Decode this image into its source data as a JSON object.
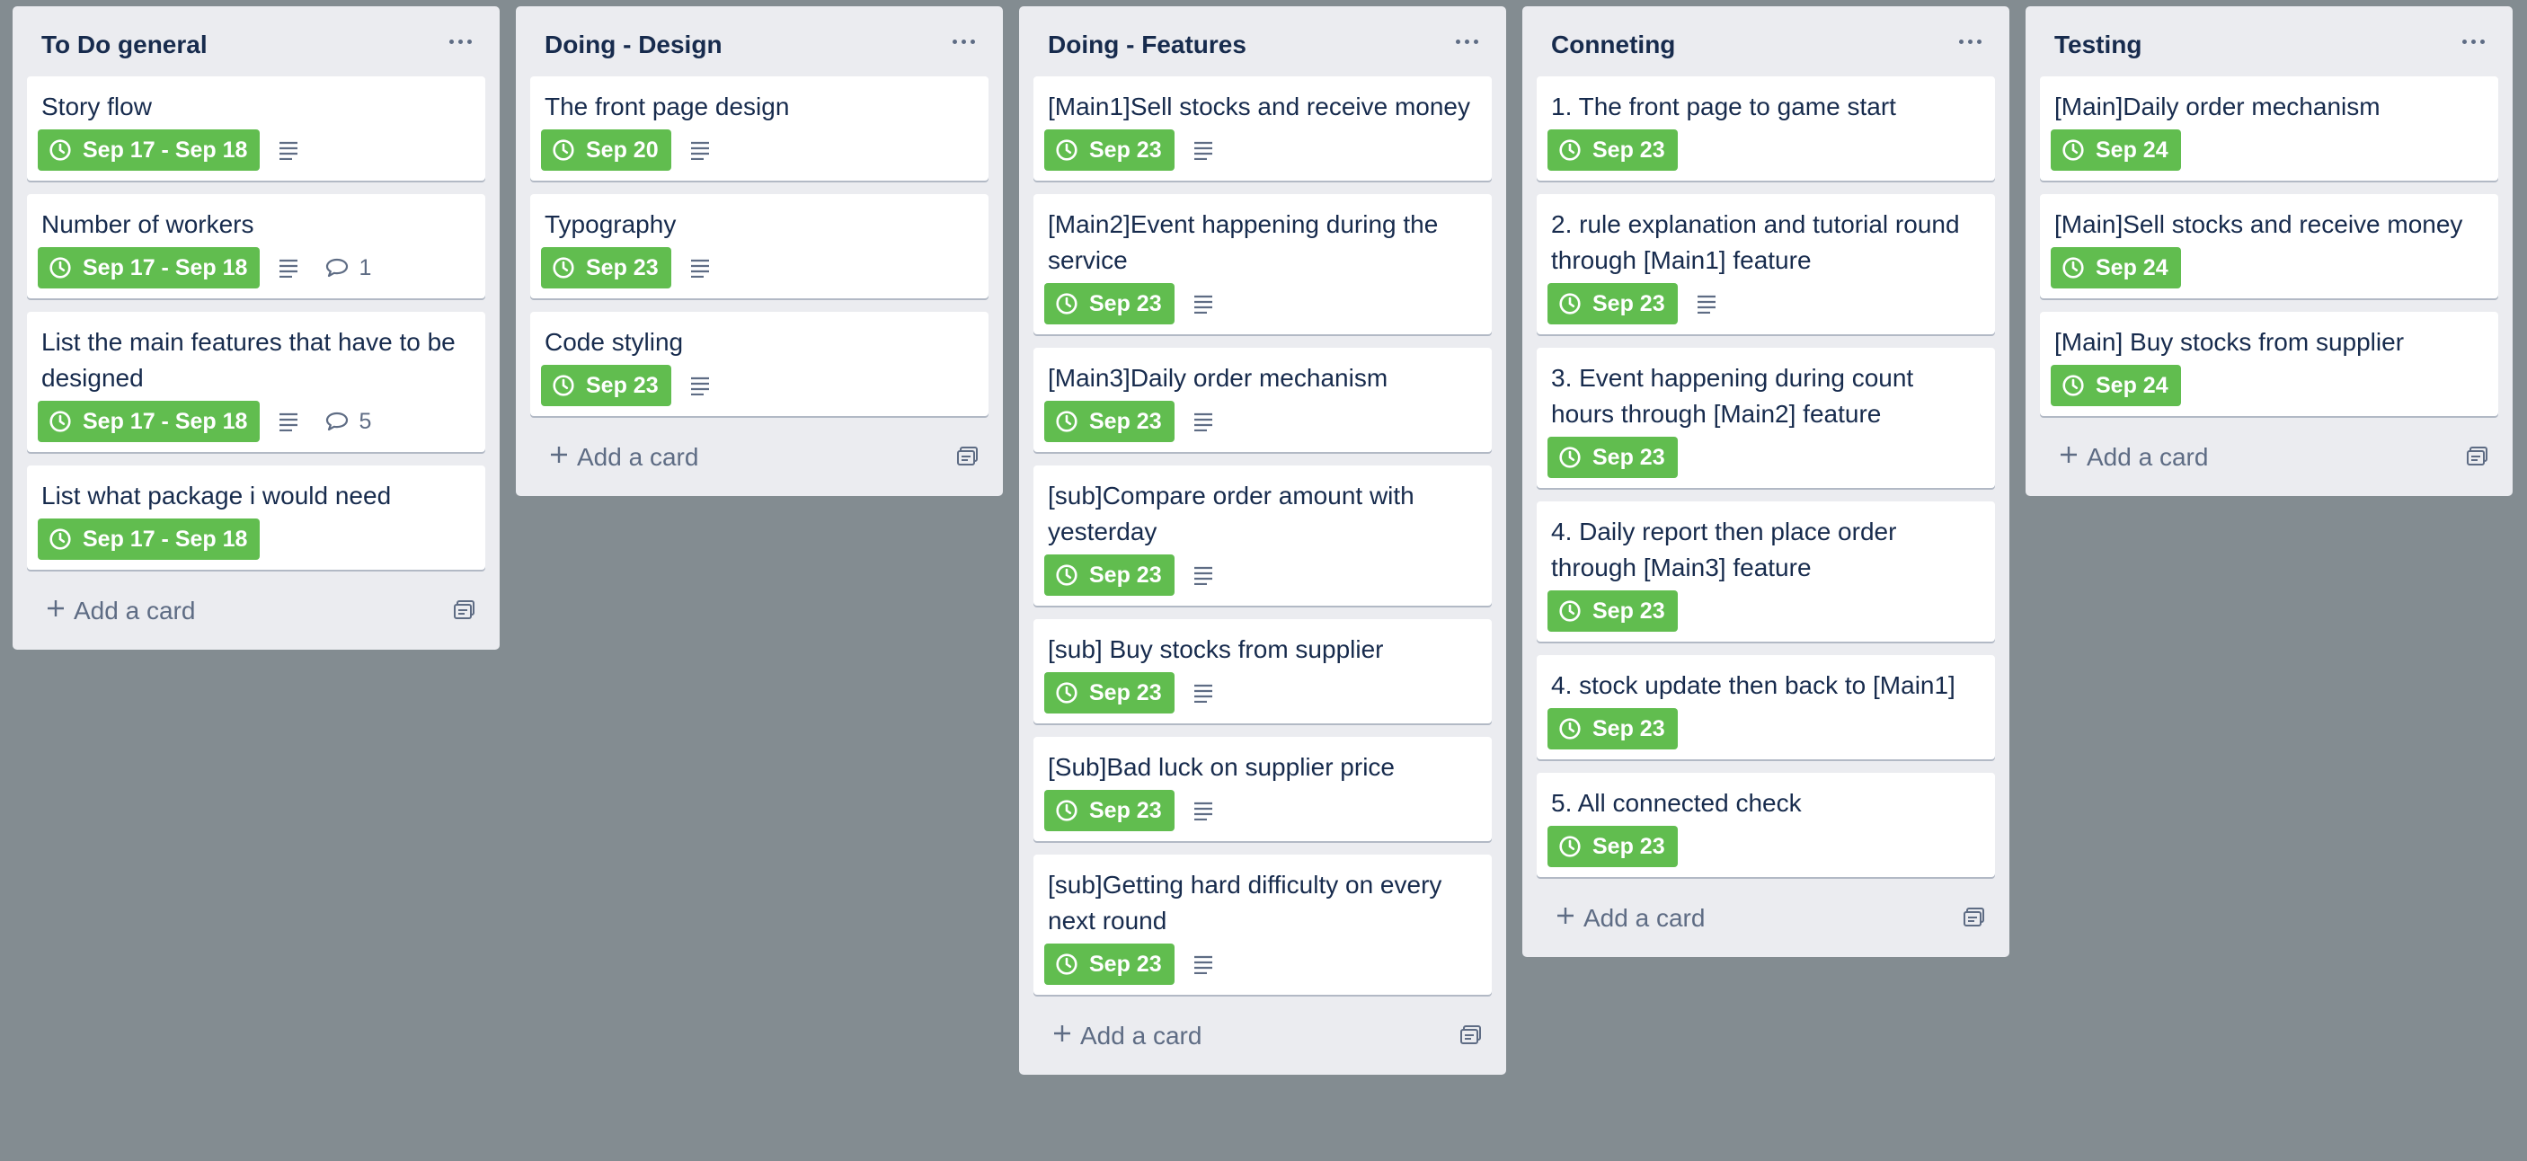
{
  "lists": [
    {
      "title": "To Do general",
      "add_label": "Add a card",
      "cards": [
        {
          "title": "Story flow",
          "due": "Sep 17 - Sep 18"
        },
        {
          "title": "Number of workers",
          "due": "Sep 17 - Sep 18",
          "comments": "1"
        },
        {
          "title": "List the main features that have to be designed",
          "due": "Sep 17 - Sep 18",
          "comments": "5"
        },
        {
          "title": "List what package i would need",
          "due": "Sep 17 - Sep 18"
        }
      ]
    },
    {
      "title": "Doing - Design",
      "add_label": "Add a card",
      "cards": [
        {
          "title": "The front page design",
          "due": "Sep 20"
        },
        {
          "title": "Typography",
          "due": "Sep 23"
        },
        {
          "title": "Code styling",
          "due": "Sep 23"
        }
      ]
    },
    {
      "title": "Doing - Features",
      "add_label": "Add a card",
      "cards": [
        {
          "title": "[Main1]Sell stocks and receive money",
          "due": "Sep 23"
        },
        {
          "title": "[Main2]Event happening during the service",
          "due": "Sep 23"
        },
        {
          "title": "[Main3]Daily order mechanism",
          "due": "Sep 23"
        },
        {
          "title": "[sub]Compare order amount with yesterday",
          "due": "Sep 23"
        },
        {
          "title": "[sub] Buy stocks from supplier",
          "due": "Sep 23"
        },
        {
          "title": "[Sub]Bad luck on supplier price",
          "due": "Sep 23"
        },
        {
          "title": "[sub]Getting hard difficulty on every next round",
          "due": "Sep 23"
        }
      ]
    },
    {
      "title": "Conneting",
      "add_label": "Add a card",
      "cards": [
        {
          "title": "1. The front page to game start",
          "due": "Sep 23"
        },
        {
          "title": "2. rule explanation and tutorial round through [Main1] feature",
          "due": "Sep 23"
        },
        {
          "title": "3. Event happening during count hours through [Main2] feature",
          "due": "Sep 23"
        },
        {
          "title": "4. Daily report then place order through [Main3] feature",
          "due": "Sep 23"
        },
        {
          "title": "4. stock update then back to [Main1]",
          "due": "Sep 23"
        },
        {
          "title": "5. All connected check",
          "due": "Sep 23"
        }
      ]
    },
    {
      "title": "Testing",
      "add_label": "Add a card",
      "cards": [
        {
          "title": "[Main]Daily order mechanism",
          "due": "Sep 24"
        },
        {
          "title": "[Main]Sell stocks and receive money",
          "due": "Sep 24"
        },
        {
          "title": "[Main] Buy stocks from supplier",
          "due": "Sep 24"
        }
      ]
    }
  ],
  "colors": {
    "board_bg": "#838c91",
    "list_bg": "#ebecf0",
    "due_badge": "#61bd4f"
  },
  "icons": [
    "clock-icon",
    "description-icon",
    "comment-icon",
    "plus-icon",
    "card-template-icon",
    "more-options-icon"
  ]
}
